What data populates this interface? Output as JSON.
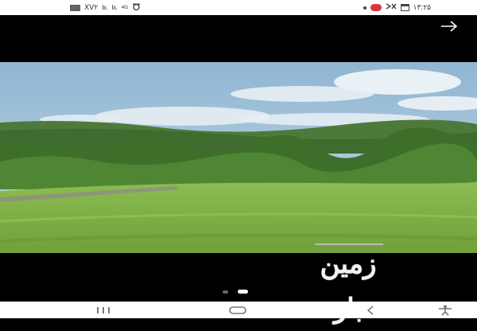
{
  "status_bar": {
    "left_text": "XV۲",
    "signal_1": "lıı.",
    "signal_2": "lıı.",
    "network": "4G",
    "time": "۱۳:۲۵"
  },
  "viewer": {
    "watermark_text": "زمین باز",
    "page_count": 2,
    "active_page": 2
  },
  "icons": {
    "forward": "arrow-right-icon",
    "recents": "recent-apps-icon",
    "home": "home-icon",
    "back": "back-icon",
    "accessibility": "accessibility-icon"
  },
  "colors": {
    "sky": "#9fc0d8",
    "grass": "#7fb24a",
    "missed_call": "#d9363e"
  }
}
